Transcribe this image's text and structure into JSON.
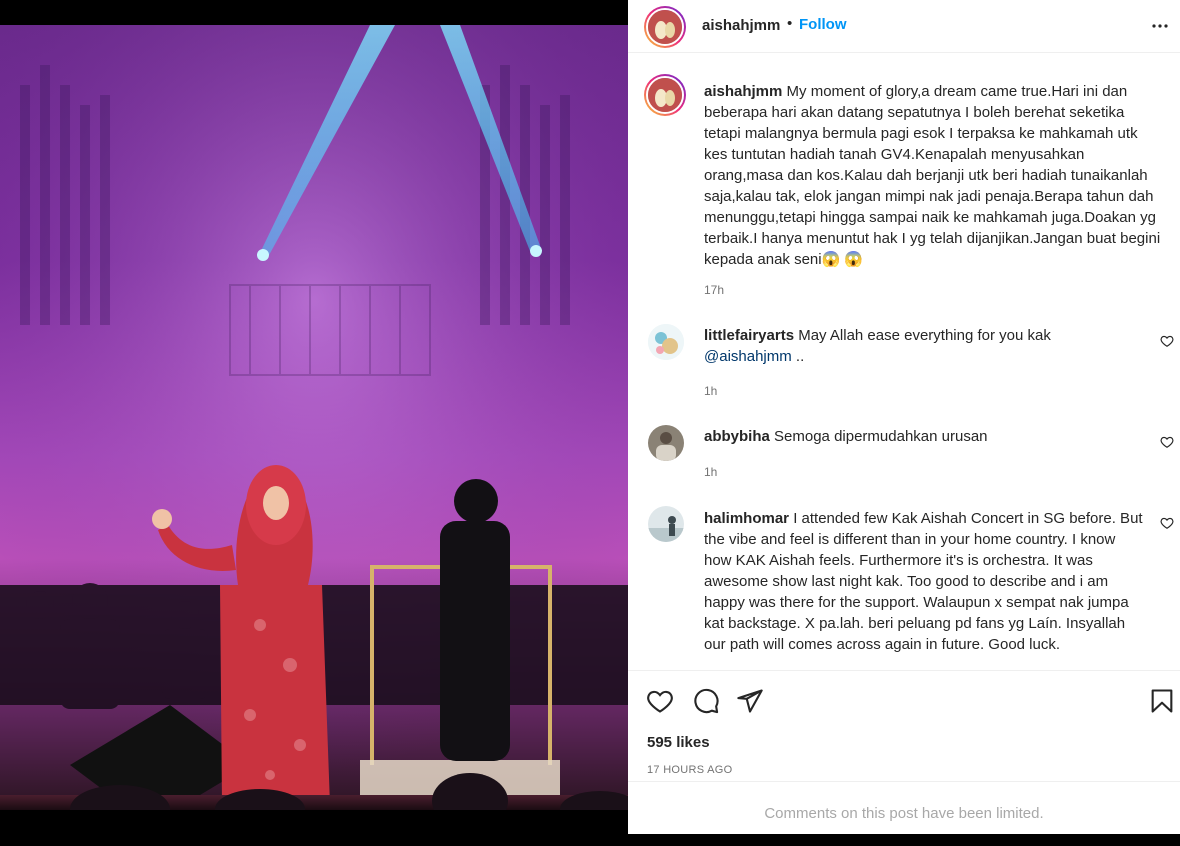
{
  "header": {
    "username": "aishahjmm",
    "separator": "•",
    "follow_label": "Follow",
    "more_icon": "more-horizontal-icon"
  },
  "caption": {
    "username": "aishahjmm",
    "text": "My moment of glory,a dream came true.Hari ini dan beberapa hari akan datang sepatutnya I boleh berehat seketika tetapi malangnya bermula pagi esok I terpaksa ke mahkamah utk kes tuntutan hadiah tanah GV4.Kenapalah menyusahkan orang,masa dan kos.Kalau dah berjanji utk beri hadiah tunaikanlah saja,kalau tak, elok jangan mimpi nak jadi penaja.Berapa tahun dah menunggu,tetapi hingga sampai naik ke mahkamah juga.Doakan yg terbaik.I hanya menuntut hak I yg telah dijanjikan.Jangan buat begini kepada anak seni😱 😱",
    "time": "17h"
  },
  "comments": [
    {
      "username": "littlefairyarts",
      "text": "May Allah ease everything for you kak",
      "mention": "@aishahjmm",
      "suffix": " ..",
      "time": "1h"
    },
    {
      "username": "abbybiha",
      "text": "Semoga dipermudahkan urusan",
      "time": "1h"
    },
    {
      "username": "halimhomar",
      "text": "I attended few Kak Aishah Concert in SG before. But the vibe and feel is different than in your home country. I know how KAK Aishah feels. Furthermore it's is orchestra. It was awesome show last night kak. Too good to describe and i am happy was there for the support. Walaupun x sempat nak jumpa kat backstage. X pa.lah. beri peluang pd fans yg Laín. Insyallah our path will comes across again in future. Good luck."
    }
  ],
  "actions": {
    "like_icon": "heart-icon",
    "comment_icon": "comment-icon",
    "share_icon": "send-icon",
    "save_icon": "bookmark-icon"
  },
  "likes": "595 likes",
  "posted_ago": "17 HOURS AGO",
  "comments_limited": "Comments on this post have been limited.",
  "colors": {
    "link": "#0095f6",
    "text": "#262626",
    "muted": "#737373",
    "mention": "#00376b"
  }
}
